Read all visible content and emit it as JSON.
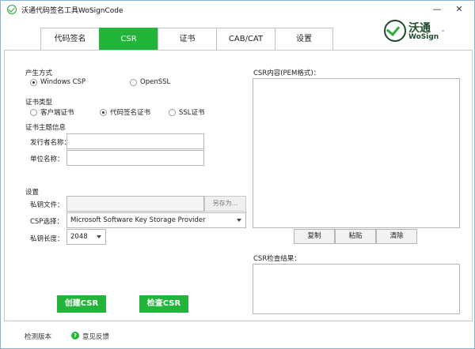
{
  "window": {
    "title": "沃通代码签名工具WoSignCode",
    "minimize": "—",
    "close": "✕"
  },
  "tabs": [
    {
      "label": "代码签名",
      "active": false
    },
    {
      "label": "CSR",
      "active": true
    },
    {
      "label": "证书",
      "active": false
    },
    {
      "label": "CAB/CAT",
      "active": false
    },
    {
      "label": "设置",
      "active": false
    }
  ],
  "logo": {
    "cn": "沃通",
    "en": "WoSign",
    "tm": "™"
  },
  "generation": {
    "heading": "产生方式",
    "options": [
      {
        "label": "Windows CSP",
        "selected": true
      },
      {
        "label": "OpenSSL",
        "selected": false
      }
    ]
  },
  "cert_type": {
    "heading": "证书类型",
    "options": [
      {
        "label": "客户端证书",
        "selected": false
      },
      {
        "label": "代码签名证书",
        "selected": true
      },
      {
        "label": "SSL证书",
        "selected": false
      }
    ]
  },
  "subject": {
    "heading": "证书主题信息",
    "issuer_label": "发行者名称：",
    "issuer_value": "",
    "org_label": "单位名称：",
    "org_value": ""
  },
  "settings": {
    "heading": "设置",
    "key_file_label": "私钥文件：",
    "key_file_value": "",
    "save_as": "另存为...",
    "csp_label": "CSP选择：",
    "csp_value": "Microsoft Software Key Storage Provider",
    "key_length_label": "私钥长度：",
    "key_length_value": "2048"
  },
  "csr_content": {
    "label": "CSR内容(PEM格式)：",
    "value": "",
    "copy": "复制",
    "paste": "粘贴",
    "clear": "清除"
  },
  "csr_check": {
    "label": "CSR检查结果：",
    "value": ""
  },
  "actions": {
    "create": "创建CSR",
    "check": "检查CSR"
  },
  "footer": {
    "check_version": "检测版本",
    "feedback": "意见反馈",
    "feedback_icon": "?"
  },
  "colors": {
    "accent": "#22b53a",
    "logo_dark": "#1c4a2a"
  }
}
